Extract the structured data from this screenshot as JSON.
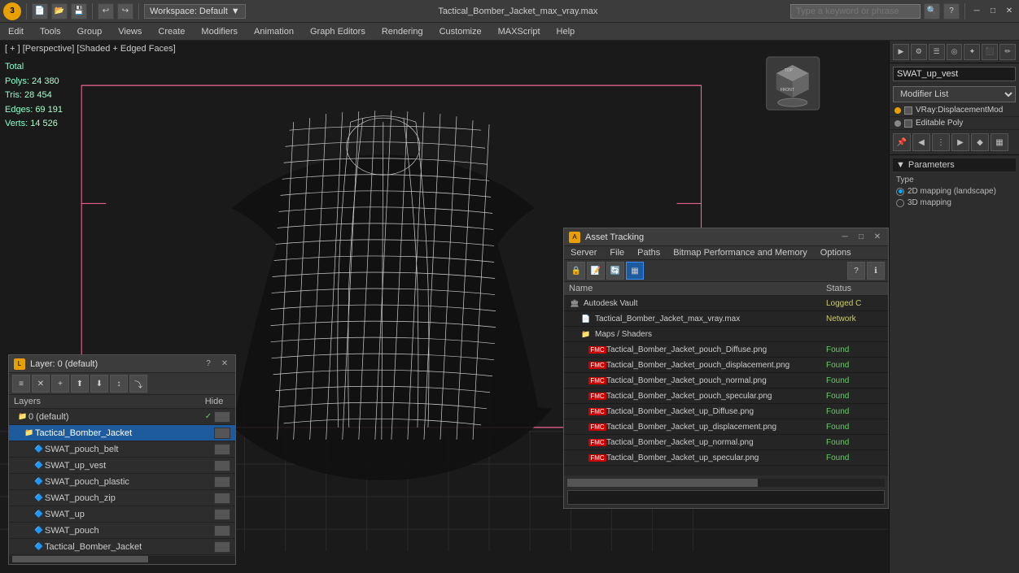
{
  "titlebar": {
    "title": "Tactical_Bomber_Jacket_max_vray.max",
    "workspace": "Workspace: Default",
    "search_placeholder": "Type a keyword or phrase",
    "logo_text": "3"
  },
  "menu": {
    "items": [
      "Edit",
      "Tools",
      "Group",
      "Views",
      "Create",
      "Modifiers",
      "Animation",
      "Graph Editors",
      "Rendering",
      "Customize",
      "MAXScript",
      "Help"
    ]
  },
  "viewport": {
    "label": "[ + ] [Perspective] [Shaded + Edged Faces]",
    "stats": {
      "polys_label": "Polys:",
      "polys_value": "24 380",
      "tris_label": "Tris:",
      "tris_value": "28 454",
      "edges_label": "Edges:",
      "edges_value": "69 191",
      "verts_label": "Verts:",
      "verts_value": "14 526",
      "total_label": "Total"
    }
  },
  "right_panel": {
    "object_name": "SWAT_up_vest",
    "modifier_list_label": "Modifier List",
    "modifiers": [
      {
        "name": "VRay:DisplacementMod",
        "type": "orange"
      },
      {
        "name": "Editable Poly",
        "type": "normal"
      }
    ],
    "parameters_header": "Parameters",
    "type_label": "Type",
    "mapping_2d": "2D mapping (landscape)",
    "mapping_3d": "3D mapping"
  },
  "layers_panel": {
    "title": "Layer: 0 (default)",
    "header_name": "Layers",
    "header_hide": "Hide",
    "items": [
      {
        "name": "0 (default)",
        "level": 0,
        "checked": true,
        "type": "folder"
      },
      {
        "name": "Tactical_Bomber_Jacket",
        "level": 1,
        "selected": true,
        "type": "folder"
      },
      {
        "name": "SWAT_pouch_belt",
        "level": 2,
        "type": "mesh"
      },
      {
        "name": "SWAT_up_vest",
        "level": 2,
        "type": "mesh"
      },
      {
        "name": "SWAT_pouch_plastic",
        "level": 2,
        "type": "mesh"
      },
      {
        "name": "SWAT_pouch_zip",
        "level": 2,
        "type": "mesh"
      },
      {
        "name": "SWAT_up",
        "level": 2,
        "type": "mesh"
      },
      {
        "name": "SWAT_pouch",
        "level": 2,
        "type": "mesh"
      },
      {
        "name": "Tactical_Bomber_Jacket",
        "level": 2,
        "type": "mesh"
      }
    ]
  },
  "asset_panel": {
    "title": "Asset Tracking",
    "menu_items": [
      "Server",
      "File",
      "Paths",
      "Bitmap Performance and Memory",
      "Options"
    ],
    "col_name": "Name",
    "col_status": "Status",
    "assets": [
      {
        "name": "Autodesk Vault",
        "level": 0,
        "status": "Logged C",
        "status_type": "logged",
        "icon": "vault"
      },
      {
        "name": "Tactical_Bomber_Jacket_max_vray.max",
        "level": 1,
        "status": "Network",
        "status_type": "network",
        "icon": "file"
      },
      {
        "name": "Maps / Shaders",
        "level": 1,
        "status": "",
        "status_type": "",
        "icon": "folder"
      },
      {
        "name": "Tactical_Bomber_Jacket_pouch_Diffuse.png",
        "level": 2,
        "status": "Found",
        "status_type": "found",
        "icon": "map"
      },
      {
        "name": "Tactical_Bomber_Jacket_pouch_displacement.png",
        "level": 2,
        "status": "Found",
        "status_type": "found",
        "icon": "map"
      },
      {
        "name": "Tactical_Bomber_Jacket_pouch_normal.png",
        "level": 2,
        "status": "Found",
        "status_type": "found",
        "icon": "map"
      },
      {
        "name": "Tactical_Bomber_Jacket_pouch_specular.png",
        "level": 2,
        "status": "Found",
        "status_type": "found",
        "icon": "map"
      },
      {
        "name": "Tactical_Bomber_Jacket_up_Diffuse.png",
        "level": 2,
        "status": "Found",
        "status_type": "found",
        "icon": "map"
      },
      {
        "name": "Tactical_Bomber_Jacket_up_displacement.png",
        "level": 2,
        "status": "Found",
        "status_type": "found",
        "icon": "map"
      },
      {
        "name": "Tactical_Bomber_Jacket_up_normal.png",
        "level": 2,
        "status": "Found",
        "status_type": "found",
        "icon": "map"
      },
      {
        "name": "Tactical_Bomber_Jacket_up_specular.png",
        "level": 2,
        "status": "Found",
        "status_type": "found",
        "icon": "map"
      }
    ]
  }
}
